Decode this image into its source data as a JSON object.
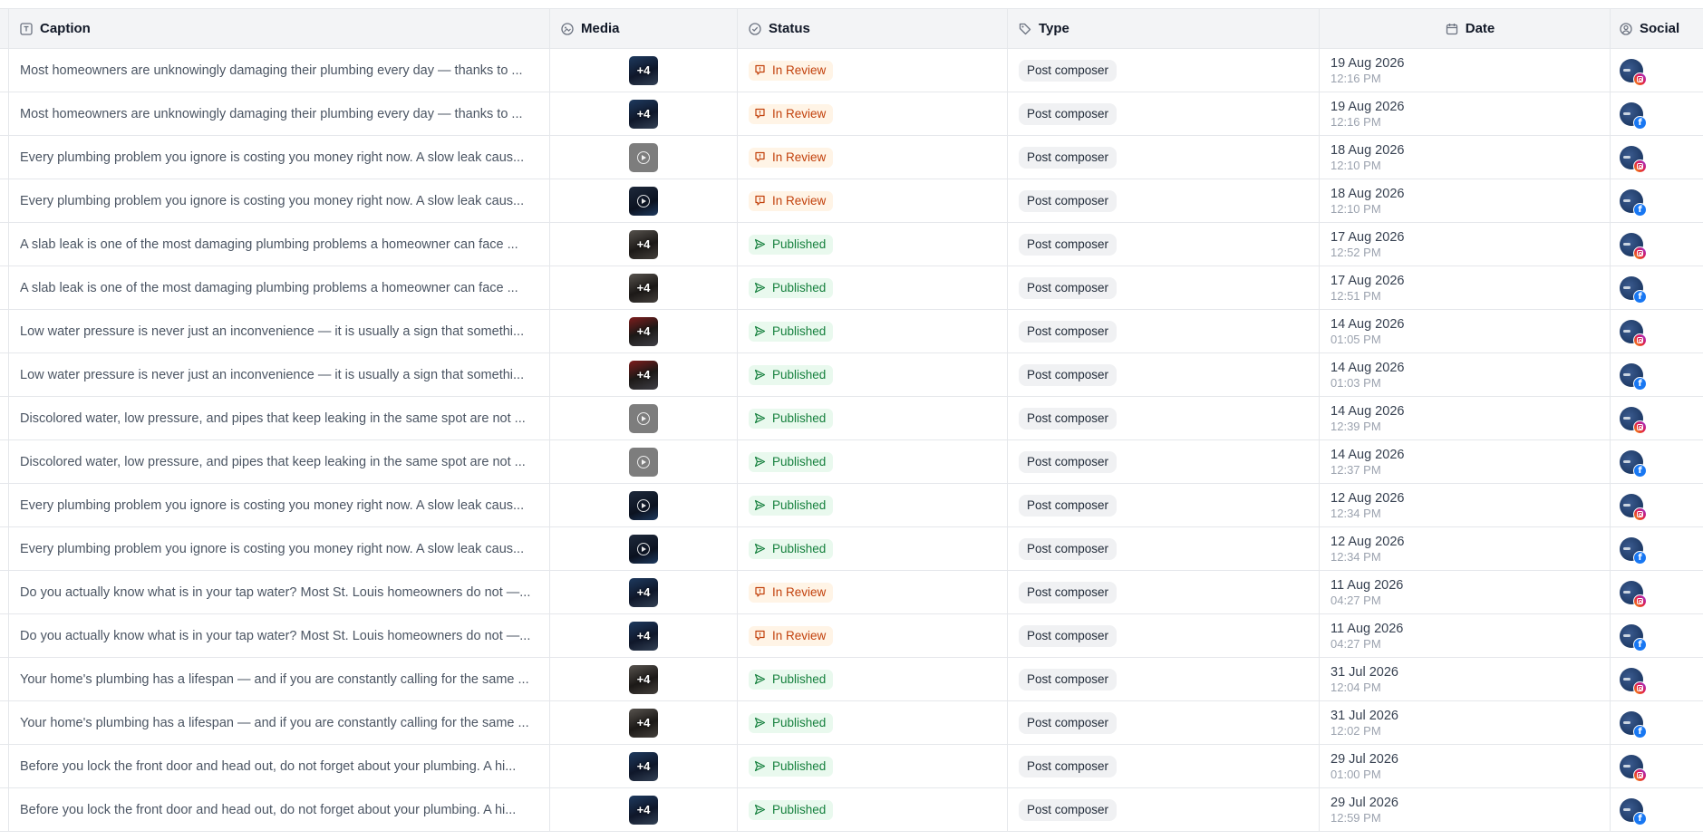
{
  "columns": {
    "caption": "Caption",
    "media": "Media",
    "status": "Status",
    "type": "Type",
    "date": "Date",
    "social": "Social"
  },
  "status_colors": {
    "In Review": "#c2410c",
    "Published": "#15803d"
  },
  "network_colors": {
    "instagram": "#e11d48",
    "facebook": "#1877f2"
  },
  "rows": [
    {
      "caption": "Most homeowners are unknowingly damaging their plumbing every day — thanks to ...",
      "media": {
        "kind": "gallery",
        "style": "dark-gallery",
        "label": "+4"
      },
      "status": "In Review",
      "type": "Post composer",
      "date": "19 Aug 2026",
      "time": "12:16 PM",
      "network": "instagram"
    },
    {
      "caption": "Most homeowners are unknowingly damaging their plumbing every day — thanks to ...",
      "media": {
        "kind": "gallery",
        "style": "dark-gallery",
        "label": "+4"
      },
      "status": "In Review",
      "type": "Post composer",
      "date": "19 Aug 2026",
      "time": "12:16 PM",
      "network": "facebook"
    },
    {
      "caption": "Every plumbing problem you ignore is costing you money right now. A slow leak caus...",
      "media": {
        "kind": "video",
        "style": "grey-video",
        "label": ""
      },
      "status": "In Review",
      "type": "Post composer",
      "date": "18 Aug 2026",
      "time": "12:10 PM",
      "network": "instagram"
    },
    {
      "caption": "Every plumbing problem you ignore is costing you money right now. A slow leak caus...",
      "media": {
        "kind": "video",
        "style": "navy-video",
        "label": ""
      },
      "status": "In Review",
      "type": "Post composer",
      "date": "18 Aug 2026",
      "time": "12:10 PM",
      "network": "facebook"
    },
    {
      "caption": "A slab leak is one of the most damaging plumbing problems a homeowner can face ...",
      "media": {
        "kind": "gallery",
        "style": "warm-gallery",
        "label": "+4"
      },
      "status": "Published",
      "type": "Post composer",
      "date": "17 Aug 2026",
      "time": "12:52 PM",
      "network": "instagram"
    },
    {
      "caption": "A slab leak is one of the most damaging plumbing problems a homeowner can face ...",
      "media": {
        "kind": "gallery",
        "style": "warm-gallery",
        "label": "+4"
      },
      "status": "Published",
      "type": "Post composer",
      "date": "17 Aug 2026",
      "time": "12:51 PM",
      "network": "facebook"
    },
    {
      "caption": "Low water pressure is never just an inconvenience — it is usually a sign that somethi...",
      "media": {
        "kind": "gallery",
        "style": "red-gallery",
        "label": "+4"
      },
      "status": "Published",
      "type": "Post composer",
      "date": "14 Aug 2026",
      "time": "01:05 PM",
      "network": "instagram"
    },
    {
      "caption": "Low water pressure is never just an inconvenience — it is usually a sign that somethi...",
      "media": {
        "kind": "gallery",
        "style": "red-gallery",
        "label": "+4"
      },
      "status": "Published",
      "type": "Post composer",
      "date": "14 Aug 2026",
      "time": "01:03 PM",
      "network": "facebook"
    },
    {
      "caption": "Discolored water, low pressure, and pipes that keep leaking in the same spot are not ...",
      "media": {
        "kind": "video",
        "style": "grey-video",
        "label": ""
      },
      "status": "Published",
      "type": "Post composer",
      "date": "14 Aug 2026",
      "time": "12:39 PM",
      "network": "instagram"
    },
    {
      "caption": "Discolored water, low pressure, and pipes that keep leaking in the same spot are not ...",
      "media": {
        "kind": "video",
        "style": "grey-video",
        "label": ""
      },
      "status": "Published",
      "type": "Post composer",
      "date": "14 Aug 2026",
      "time": "12:37 PM",
      "network": "facebook"
    },
    {
      "caption": "Every plumbing problem you ignore is costing you money right now. A slow leak caus...",
      "media": {
        "kind": "video",
        "style": "navy-video",
        "label": ""
      },
      "status": "Published",
      "type": "Post composer",
      "date": "12 Aug 2026",
      "time": "12:34 PM",
      "network": "instagram"
    },
    {
      "caption": "Every plumbing problem you ignore is costing you money right now. A slow leak caus...",
      "media": {
        "kind": "video",
        "style": "navy-video",
        "label": ""
      },
      "status": "Published",
      "type": "Post composer",
      "date": "12 Aug 2026",
      "time": "12:34 PM",
      "network": "facebook"
    },
    {
      "caption": "Do you actually know what is in your tap water? Most St. Louis homeowners do not —...",
      "media": {
        "kind": "gallery",
        "style": "dark-gallery",
        "label": "+4"
      },
      "status": "In Review",
      "type": "Post composer",
      "date": "11 Aug 2026",
      "time": "04:27 PM",
      "network": "instagram"
    },
    {
      "caption": "Do you actually know what is in your tap water? Most St. Louis homeowners do not —...",
      "media": {
        "kind": "gallery",
        "style": "dark-gallery",
        "label": "+4"
      },
      "status": "In Review",
      "type": "Post composer",
      "date": "11 Aug 2026",
      "time": "04:27 PM",
      "network": "facebook"
    },
    {
      "caption": "Your home's plumbing has a lifespan — and if you are constantly calling for the same ...",
      "media": {
        "kind": "gallery",
        "style": "warm-gallery",
        "label": "+4"
      },
      "status": "Published",
      "type": "Post composer",
      "date": "31 Jul 2026",
      "time": "12:04 PM",
      "network": "instagram"
    },
    {
      "caption": "Your home's plumbing has a lifespan — and if you are constantly calling for the same ...",
      "media": {
        "kind": "gallery",
        "style": "warm-gallery",
        "label": "+4"
      },
      "status": "Published",
      "type": "Post composer",
      "date": "31 Jul 2026",
      "time": "12:02 PM",
      "network": "facebook"
    },
    {
      "caption": "Before you lock the front door and head out, do not forget about your plumbing. A hi...",
      "media": {
        "kind": "gallery",
        "style": "dark-gallery",
        "label": "+4"
      },
      "status": "Published",
      "type": "Post composer",
      "date": "29 Jul 2026",
      "time": "01:00 PM",
      "network": "instagram"
    },
    {
      "caption": "Before you lock the front door and head out, do not forget about your plumbing. A hi...",
      "media": {
        "kind": "gallery",
        "style": "dark-gallery",
        "label": "+4"
      },
      "status": "Published",
      "type": "Post composer",
      "date": "29 Jul 2026",
      "time": "12:59 PM",
      "network": "facebook"
    }
  ]
}
